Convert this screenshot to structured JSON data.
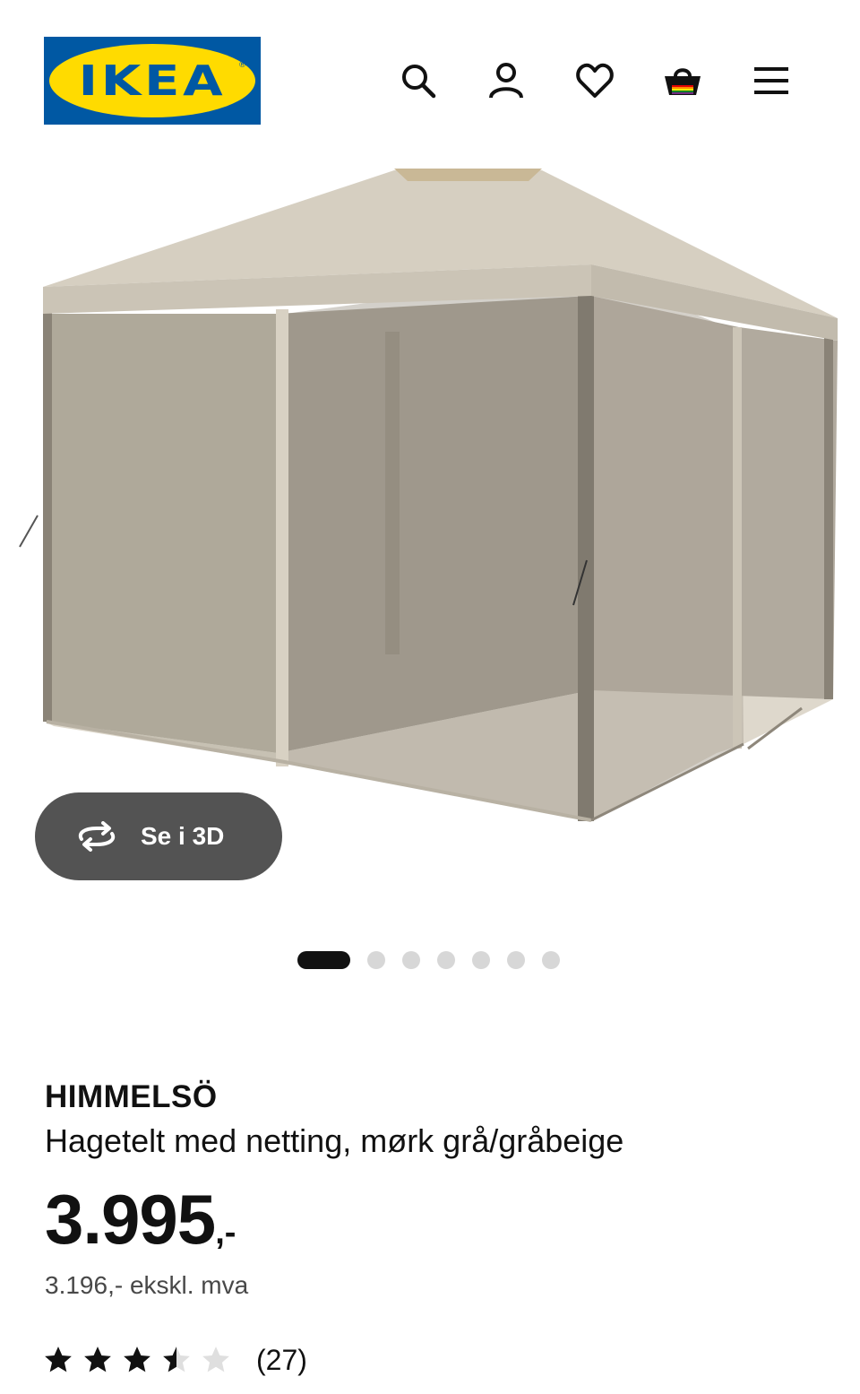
{
  "header": {
    "logo_text": "IKEA",
    "logo_reg": "®",
    "icons": [
      "search-icon",
      "account-icon",
      "heart-icon",
      "basket-icon",
      "menu-icon"
    ]
  },
  "gallery": {
    "view_3d_label": "Se i 3D",
    "view_3d_icon": "rotate-3d-icon",
    "slide_count": 7,
    "active_slide": 1
  },
  "product": {
    "brand": "HIMMELSÖ",
    "description": "Hagetelt med netting, mørk grå/gråbeige",
    "price_main": "3.995",
    "price_suffix": ",-",
    "price_excl_vat": "3.196,- ekskl. mva",
    "rating": 3.5,
    "rating_max": 5,
    "rating_count": "(27)"
  },
  "colors": {
    "ikea_blue": "#0058a3",
    "ikea_yellow": "#ffdb00",
    "button_dark": "#535353",
    "canopy": "#d6cfc1",
    "netting": "#aaa397"
  }
}
